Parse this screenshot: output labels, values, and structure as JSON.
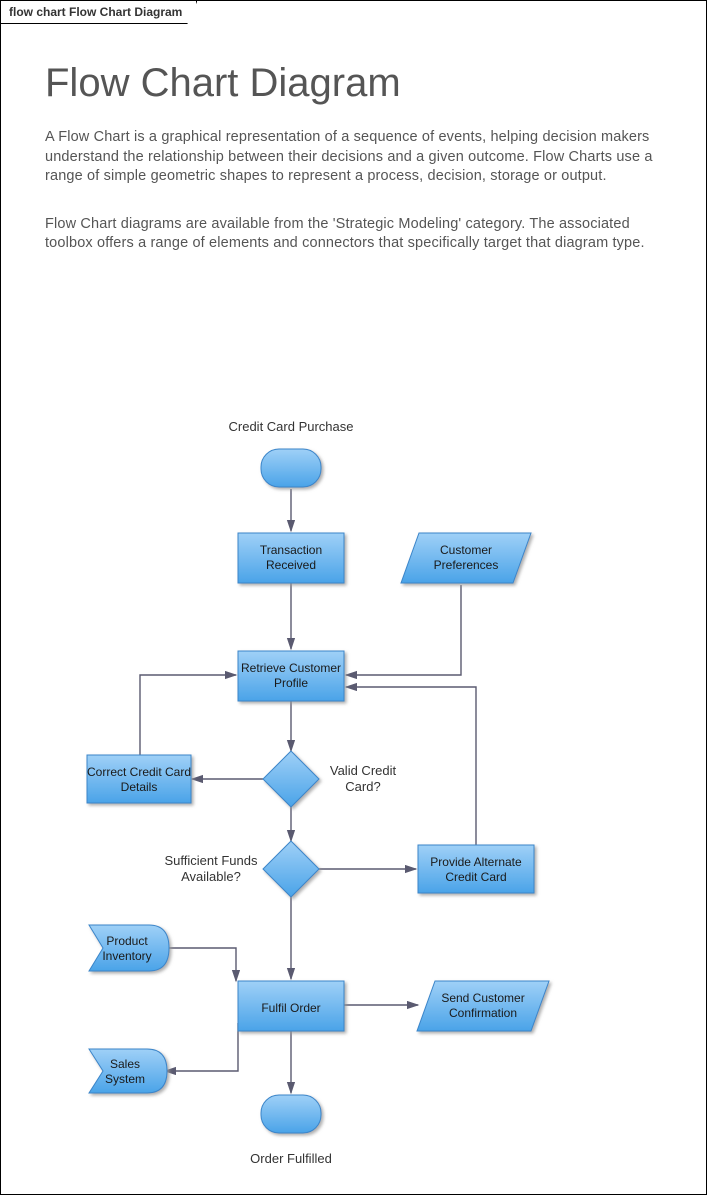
{
  "tab_label": "flow chart Flow Chart Diagram",
  "title": "Flow Chart Diagram",
  "para1": "A Flow Chart is a graphical representation of a sequence of events, helping decision makers understand the relationship between their decisions and a given outcome.  Flow Charts use a range of simple geometric shapes to represent a process, decision, storage or output.",
  "para2": "Flow Chart diagrams are available from the 'Strategic Modeling' category.  The associated toolbox offers a range of elements and connectors that specifically target that diagram type.",
  "nodes": {
    "start_label": "Credit Card Purchase",
    "transaction_received": "Transaction Received",
    "customer_preferences": "Customer Preferences",
    "retrieve_profile": "Retrieve Customer Profile",
    "correct_details": "Correct Credit Card Details",
    "valid_card_q": "Valid Credit Card?",
    "sufficient_funds_q": "Sufficient Funds Available?",
    "provide_alternate": "Provide Alternate Credit Card",
    "product_inventory": "Product Inventory",
    "fulfil_order": "Fulfil Order",
    "send_confirmation": "Send Customer Confirmation",
    "sales_system": "Sales System",
    "end_label": "Order Fulfilled"
  }
}
